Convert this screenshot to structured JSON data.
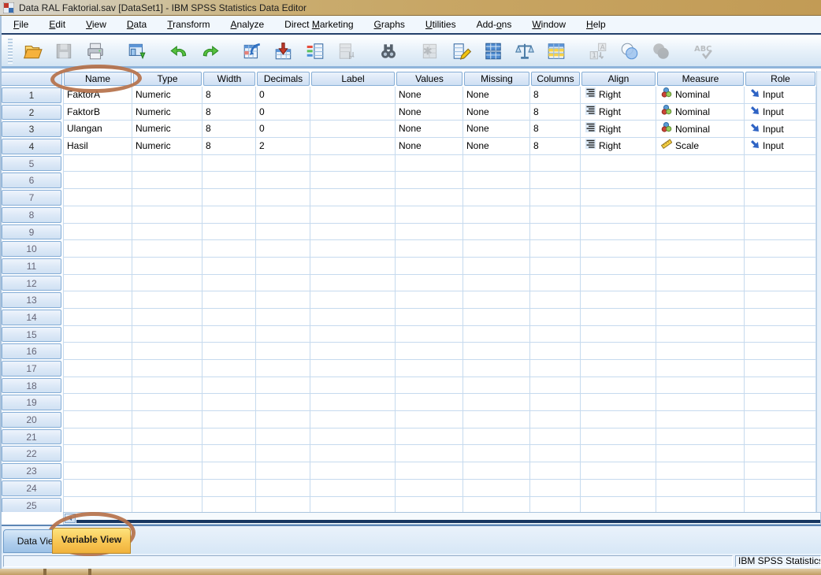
{
  "titlebar": {
    "title": "Data RAL Faktorial.sav [DataSet1] - IBM SPSS Statistics Data Editor"
  },
  "menubar": {
    "items": [
      {
        "label": "File",
        "underline": 0
      },
      {
        "label": "Edit",
        "underline": 0
      },
      {
        "label": "View",
        "underline": 0
      },
      {
        "label": "Data",
        "underline": 0
      },
      {
        "label": "Transform",
        "underline": 0
      },
      {
        "label": "Analyze",
        "underline": 0
      },
      {
        "label": "Direct Marketing",
        "underline": 7
      },
      {
        "label": "Graphs",
        "underline": 0
      },
      {
        "label": "Utilities",
        "underline": 0
      },
      {
        "label": "Add-ons",
        "underline": 4
      },
      {
        "label": "Window",
        "underline": 0
      },
      {
        "label": "Help",
        "underline": 0
      }
    ]
  },
  "toolbar": {
    "buttons": [
      {
        "icon": "open-file-icon",
        "enabled": true,
        "gap": false
      },
      {
        "icon": "save-file-icon",
        "enabled": false,
        "gap": false
      },
      {
        "icon": "print-icon",
        "enabled": true,
        "gap": false
      },
      {
        "icon": "recall-dialogs-icon",
        "enabled": true,
        "gap": true
      },
      {
        "icon": "undo-icon",
        "enabled": true,
        "gap": true
      },
      {
        "icon": "redo-icon",
        "enabled": true,
        "gap": false
      },
      {
        "icon": "goto-case-icon",
        "enabled": true,
        "gap": true
      },
      {
        "icon": "goto-variable-icon",
        "enabled": true,
        "gap": false
      },
      {
        "icon": "variables-info-icon",
        "enabled": true,
        "gap": false
      },
      {
        "icon": "descriptives-icon",
        "enabled": false,
        "gap": false
      },
      {
        "icon": "find-icon",
        "enabled": true,
        "gap": true
      },
      {
        "icon": "insert-cases-icon",
        "enabled": false,
        "gap": true
      },
      {
        "icon": "insert-variable-icon",
        "enabled": true,
        "gap": false
      },
      {
        "icon": "split-file-icon",
        "enabled": true,
        "gap": false
      },
      {
        "icon": "weight-cases-icon",
        "enabled": true,
        "gap": false
      },
      {
        "icon": "select-cases-icon",
        "enabled": true,
        "gap": false
      },
      {
        "icon": "value-labels-icon",
        "enabled": false,
        "gap": true
      },
      {
        "icon": "use-variable-sets-icon",
        "enabled": true,
        "gap": false
      },
      {
        "icon": "show-all-variables-icon",
        "enabled": false,
        "gap": false
      },
      {
        "icon": "spell-check-icon",
        "enabled": false,
        "gap": true
      }
    ]
  },
  "grid": {
    "column_headers": [
      "Name",
      "Type",
      "Width",
      "Decimals",
      "Label",
      "Values",
      "Missing",
      "Columns",
      "Align",
      "Measure",
      "Role"
    ],
    "variables": [
      {
        "row": "1",
        "name": "FaktorA",
        "type": "Numeric",
        "width": "8",
        "decimals": "0",
        "label": "",
        "values": "None",
        "missing": "None",
        "columns": "8",
        "align": "Right",
        "measure": "Nominal",
        "role": "Input"
      },
      {
        "row": "2",
        "name": "FaktorB",
        "type": "Numeric",
        "width": "8",
        "decimals": "0",
        "label": "",
        "values": "None",
        "missing": "None",
        "columns": "8",
        "align": "Right",
        "measure": "Nominal",
        "role": "Input"
      },
      {
        "row": "3",
        "name": "Ulangan",
        "type": "Numeric",
        "width": "8",
        "decimals": "0",
        "label": "",
        "values": "None",
        "missing": "None",
        "columns": "8",
        "align": "Right",
        "measure": "Nominal",
        "role": "Input"
      },
      {
        "row": "4",
        "name": "Hasil",
        "type": "Numeric",
        "width": "8",
        "decimals": "2",
        "label": "",
        "values": "None",
        "missing": "None",
        "columns": "8",
        "align": "Right",
        "measure": "Scale",
        "role": "Input"
      }
    ],
    "empty_rows": [
      "5",
      "6",
      "7",
      "8",
      "9",
      "10",
      "11",
      "12",
      "13",
      "14",
      "15",
      "16",
      "17",
      "18",
      "19",
      "20",
      "21",
      "22",
      "23",
      "24",
      "25"
    ]
  },
  "tabs": {
    "items": [
      {
        "label": "Data View",
        "active": false
      },
      {
        "label": "Variable View",
        "active": true
      }
    ]
  },
  "status_bar": {
    "left": "",
    "right": "IBM SPSS Statistics P"
  },
  "annotations": {
    "color": "#b5714a",
    "circled": [
      "Name column header",
      "Variable View tab"
    ]
  }
}
